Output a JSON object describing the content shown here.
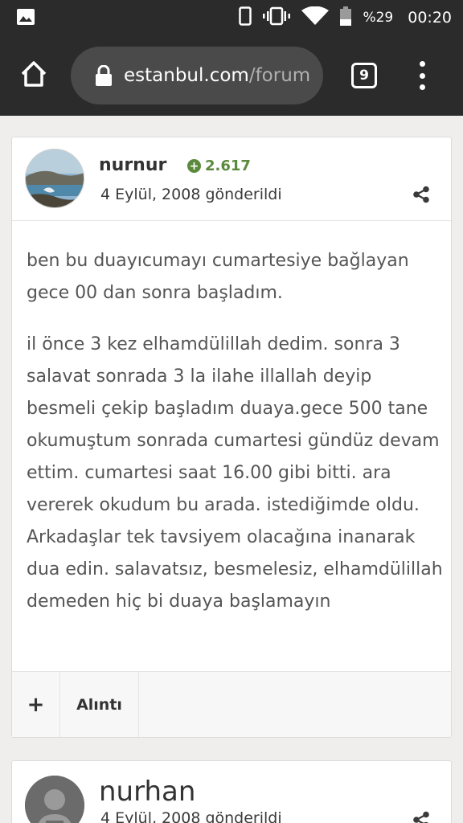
{
  "status_bar": {
    "battery_percent": "%29",
    "time": "00:20",
    "icons": [
      "gallery-icon",
      "phone-icon",
      "vibrate-icon",
      "wifi-icon",
      "battery-icon"
    ]
  },
  "browser": {
    "url_host": "estanbul.com",
    "url_path": "/forum",
    "tab_count": "9"
  },
  "posts": [
    {
      "username": "nurnur",
      "reputation": "2.617",
      "date": "4 Eylül, 2008 gönderildi",
      "paragraphs": [
        "ben bu duayıcumayı cumartesiye bağlayan gece 00 dan sonra başladım.",
        "il önce 3 kez elhamdülillah dedim. sonra 3 salavat sonrada 3 la ilahe illallah deyip besmeli çekip başladım duaya.gece 500 tane okumuştum sonrada cumartesi gündüz devam ettim. cumartesi saat 16.00 gibi bitti. ara vererek okudum bu arada. istediğimde oldu. Arkadaşlar tek tavsiyem olacağına inanarak dua edin. salavatsız, besmelesiz, elhamdülillah demeden hiç bi duaya başlamayın"
      ],
      "plus_label": "+",
      "quote_label": "Alıntı"
    },
    {
      "username": "nurhan",
      "date": "4 Eylül, 2008 gönderildi"
    }
  ],
  "colors": {
    "bar_bg": "#2b2b2b",
    "reputation": "#5b8a3c",
    "page_bg": "#efeeec"
  }
}
